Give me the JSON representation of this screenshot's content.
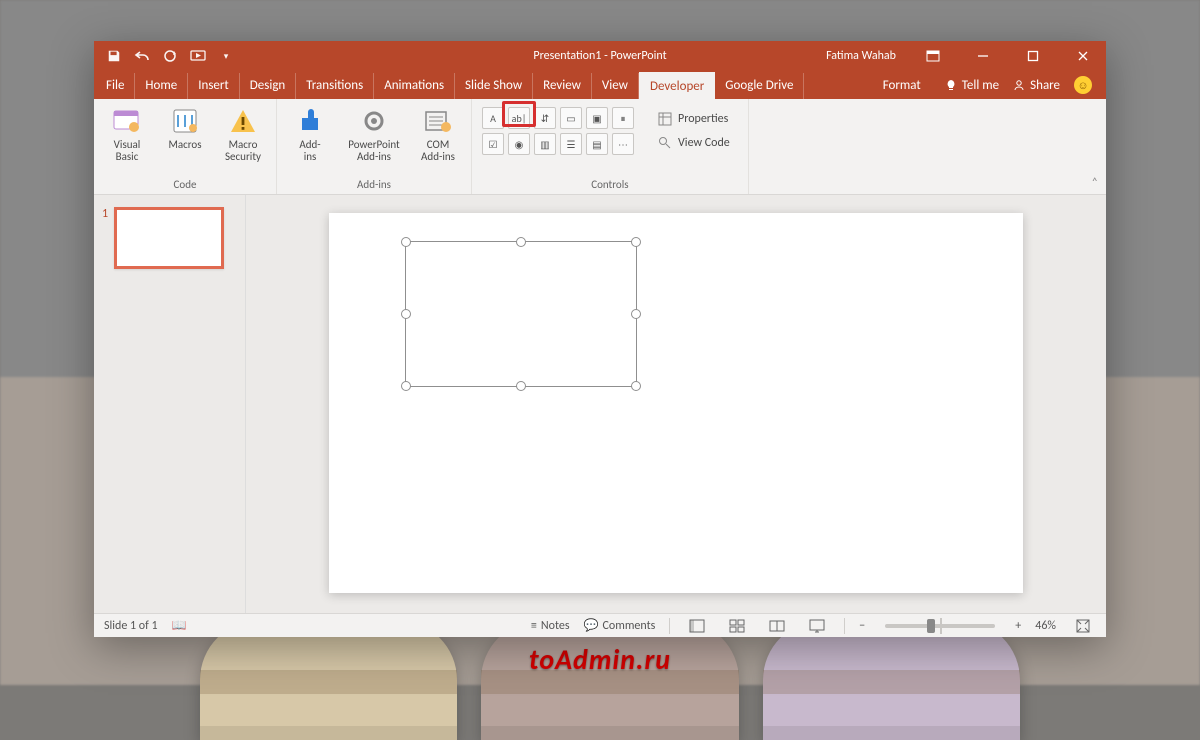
{
  "window": {
    "title": "Presentation1 - PowerPoint",
    "user": "Fatima Wahab"
  },
  "qat": {
    "items": [
      "save",
      "undo",
      "redo",
      "start-from-beginning",
      "customize"
    ]
  },
  "tabs": {
    "items": [
      {
        "label": "File"
      },
      {
        "label": "Home"
      },
      {
        "label": "Insert"
      },
      {
        "label": "Design"
      },
      {
        "label": "Transitions"
      },
      {
        "label": "Animations"
      },
      {
        "label": "Slide Show"
      },
      {
        "label": "Review"
      },
      {
        "label": "View"
      },
      {
        "label": "Developer",
        "active": true
      },
      {
        "label": "Google Drive"
      },
      {
        "label": "Format"
      }
    ],
    "tell_me": "Tell me",
    "share": "Share"
  },
  "ribbon": {
    "groups": {
      "code": {
        "label": "Code",
        "visual_basic": "Visual\nBasic",
        "macros": "Macros",
        "macro_security": "Macro\nSecurity"
      },
      "addins": {
        "label": "Add-ins",
        "add_ins": "Add-\nins",
        "pp_addins": "PowerPoint\nAdd-ins",
        "com_addins": "COM\nAdd-ins"
      },
      "controls": {
        "label": "Controls",
        "properties": "Properties",
        "view_code": "View Code"
      }
    }
  },
  "thumbnails": {
    "slide1_num": "1"
  },
  "statusbar": {
    "slide_counter": "Slide 1 of 1",
    "notes": "Notes",
    "comments": "Comments",
    "zoom_pct": "46%"
  },
  "watermark": "toAdmin.ru"
}
